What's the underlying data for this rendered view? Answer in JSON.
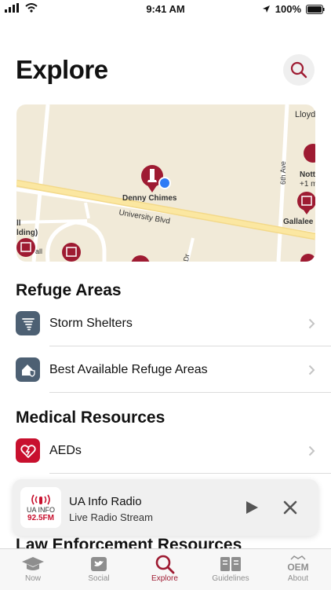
{
  "status": {
    "time": "9:41 AM",
    "battery": "100%"
  },
  "header": {
    "title": "Explore"
  },
  "map": {
    "labels": {
      "lloyd": "Lloyd",
      "denny": "Denny Chimes",
      "univ": "University Blvd",
      "sixth": "6th Ave",
      "notts": "Nott",
      "notts2": "+1 m",
      "gallalee": "Gallalee",
      "building": "ll",
      "building2": "lding)",
      "hall": "all",
      "dr": "Dr"
    }
  },
  "refuge": {
    "title": "Refuge Areas",
    "items": [
      {
        "label": "Storm Shelters",
        "icon": "tornado-icon"
      },
      {
        "label": "Best Available Refuge Areas",
        "icon": "house-shield-icon"
      }
    ]
  },
  "medical": {
    "title": "Medical Resources",
    "items": [
      {
        "label": "AEDs",
        "icon": "aed-heart-icon"
      }
    ]
  },
  "player": {
    "title": "UA Info Radio",
    "subtitle": "Live Radio Stream",
    "art_line1": "UA INFO",
    "art_line2": "92.5FM"
  },
  "law": {
    "title": "Law Enforcement Resources"
  },
  "tabs": [
    {
      "label": "Now",
      "icon": "graduation-cap-icon",
      "active": false
    },
    {
      "label": "Social",
      "icon": "twitter-icon",
      "active": false
    },
    {
      "label": "Explore",
      "icon": "search-icon",
      "active": true
    },
    {
      "label": "Guidelines",
      "icon": "book-icon",
      "active": false
    },
    {
      "label": "About",
      "icon": "oem-logo-icon",
      "active": false
    }
  ],
  "colors": {
    "accent": "#9e1b32",
    "map_bg": "#f1ead8",
    "road": "#fbe7a1",
    "user_dot": "#2f7cf6"
  }
}
